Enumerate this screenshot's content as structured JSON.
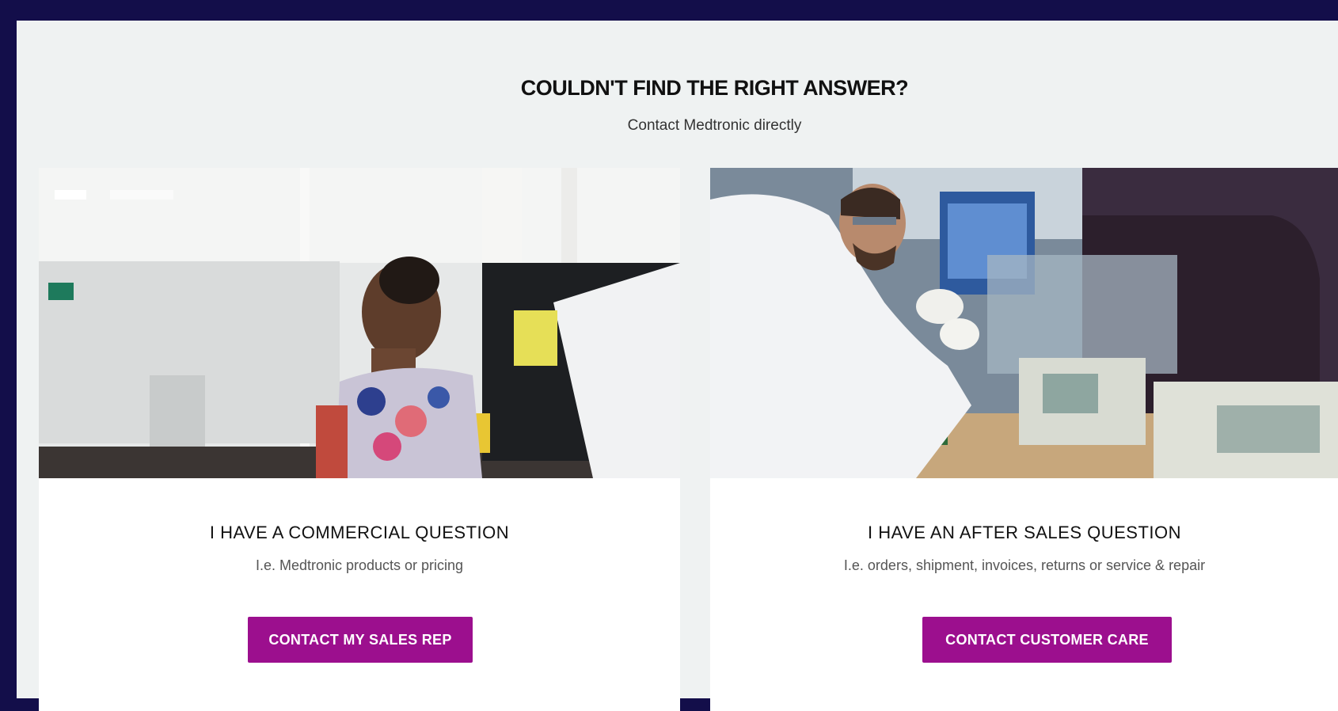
{
  "header": {
    "title": "COULDN'T FIND THE RIGHT ANSWER?",
    "subtitle": "Contact Medtronic directly"
  },
  "cards": [
    {
      "heading": "I HAVE A COMMERCIAL QUESTION",
      "description": "I.e. Medtronic products or pricing",
      "button_label": "CONTACT MY SALES REP",
      "photo": "woman-at-computer-photo"
    },
    {
      "heading": "I HAVE AN AFTER SALES QUESTION",
      "description": "I.e. orders, shipment, invoices, returns or service & repair",
      "button_label": "CONTACT CUSTOMER CARE",
      "photo": "lab-technician-photo"
    }
  ],
  "colors": {
    "page_background": "#130e4a",
    "panel_background": "#eff2f2",
    "button": "#9c0f8e"
  }
}
